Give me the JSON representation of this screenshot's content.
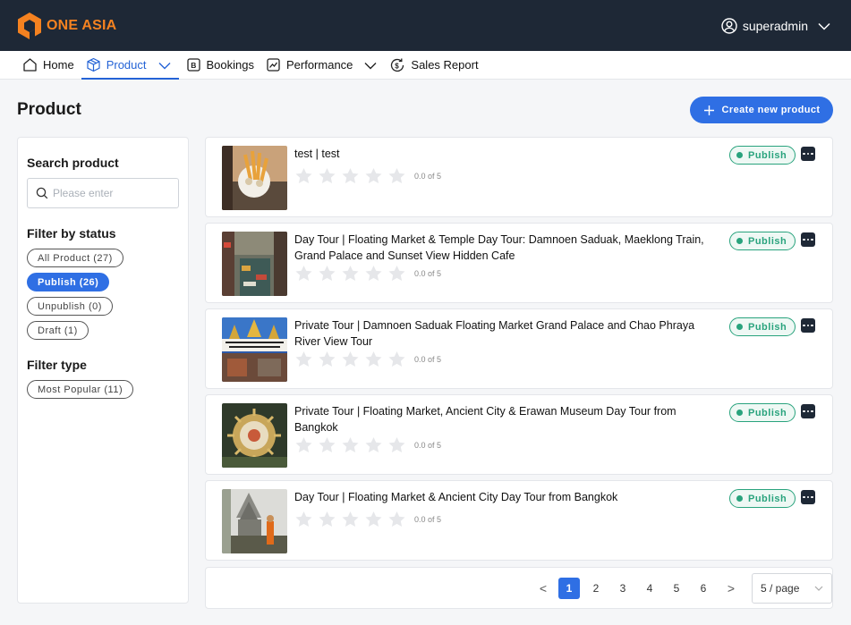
{
  "brand": {
    "name": "ONE ASIA",
    "accent": "#f58220"
  },
  "user": {
    "name": "superadmin"
  },
  "nav": {
    "home": "Home",
    "product": "Product",
    "bookings": "Bookings",
    "performance": "Performance",
    "sales_report": "Sales Report"
  },
  "page": {
    "title": "Product",
    "create_label": "Create new product"
  },
  "sidebar": {
    "search_heading": "Search product",
    "search_placeholder": "Please enter",
    "status_heading": "Filter by status",
    "status_filters": [
      "All Product (27)",
      "Publish (26)",
      "Unpublish (0)",
      "Draft (1)"
    ],
    "selected_status": "Publish (26)",
    "type_heading": "Filter type",
    "type_filters": [
      "Most Popular (11)"
    ]
  },
  "products": [
    {
      "title": "test | test",
      "rating": "0.0 of 5",
      "status": "Publish",
      "thumb": "food-vendor"
    },
    {
      "title": "Day Tour | Floating Market & Temple Day Tour: Damnoen Saduak, Maeklong Train, Grand Palace and Sunset View Hidden Cafe",
      "rating": "0.0 of 5",
      "status": "Publish",
      "thumb": "floating-market"
    },
    {
      "title": "Private Tour | Damnoen Saduak Floating Market Grand Palace and Chao Phraya River View Tour",
      "rating": "0.0 of 5",
      "status": "Publish",
      "thumb": "temple-collage"
    },
    {
      "title": "Private Tour | Floating Market, Ancient City & Erawan Museum Day Tour from Bangkok",
      "rating": "0.0 of 5",
      "status": "Publish",
      "thumb": "ornament"
    },
    {
      "title": "Day Tour | Floating Market & Ancient City Day Tour from Bangkok",
      "rating": "0.0 of 5",
      "status": "Publish",
      "thumb": "pavilion-monk"
    }
  ],
  "pagination": {
    "prev": "<",
    "next": ">",
    "pages": [
      "1",
      "2",
      "3",
      "4",
      "5",
      "6"
    ],
    "current": "1",
    "page_size": "5 / page"
  },
  "colors": {
    "primary": "#2f6fe4",
    "publish": "#29a37d",
    "topbar": "#1e2836"
  }
}
